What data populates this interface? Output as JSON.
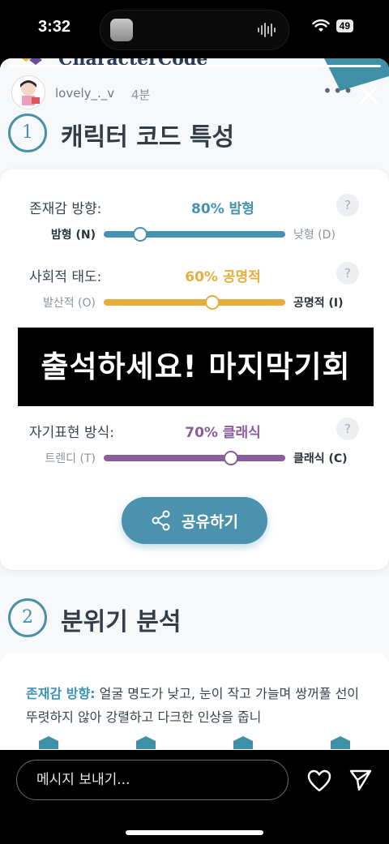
{
  "status_bar": {
    "time": "3:32",
    "battery": "49"
  },
  "story": {
    "username": "lovely_._v",
    "age": "4분",
    "progress": 1.0,
    "brand": "CharacterCode"
  },
  "section1": {
    "number": "1",
    "title": "캐릭터 코드 특성"
  },
  "traits": [
    {
      "label": "존재감 방향:",
      "value": "80% 밤형",
      "left": "밤형 (N)",
      "right": "낮형 (D)",
      "level": 0.2,
      "active_side": "left",
      "color": "#4593b0"
    },
    {
      "label": "사회적 태도:",
      "value": "60% 공명적",
      "left": "발산적 (O)",
      "right": "공명적 (I)",
      "level": 0.6,
      "active_side": "right",
      "color": "#e5ae3d"
    },
    {
      "label": "자기표현 방식:",
      "value": "70% 클래식",
      "left": "트렌디 (T)",
      "right": "클래식 (C)",
      "level": 0.7,
      "active_side": "right",
      "color": "#8a5d9b"
    }
  ],
  "help_glyph": "?",
  "banner": {
    "text": "출석하세요! 마지막기회"
  },
  "share": {
    "label": "공유하기",
    "icon": "share-icon"
  },
  "section2": {
    "number": "2",
    "title": "분위기 분석"
  },
  "analysis": {
    "key": "존재감 방향:",
    "text": " 얼굴 명도가 낮고, 눈이 작고 가늘며 쌍꺼풀 선이 뚜렷하지 않아 강렬하고 다크한 인상을 줍니"
  },
  "bottom_bar": {
    "placeholder": "메시지 보내기...",
    "icons": [
      "heart-icon",
      "send-icon"
    ]
  }
}
